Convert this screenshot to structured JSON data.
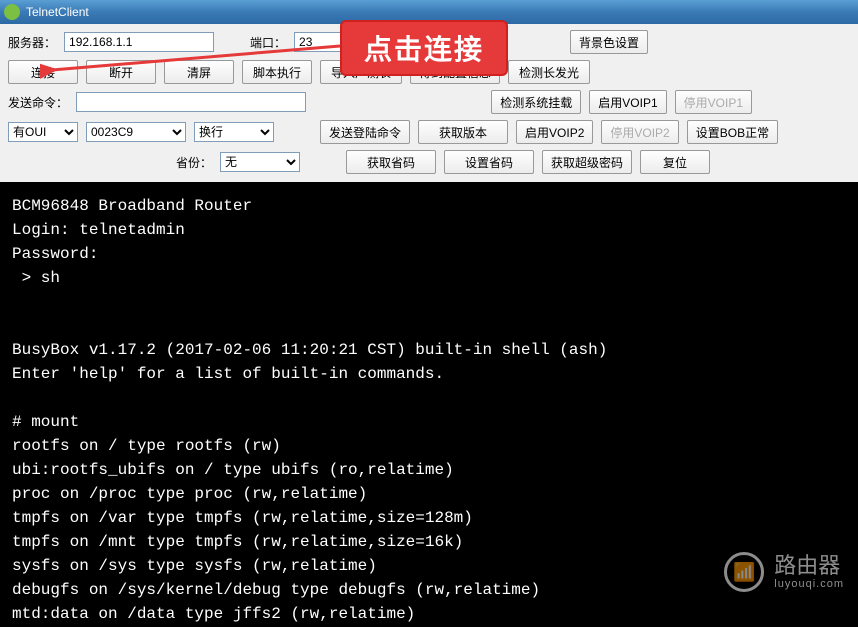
{
  "window": {
    "title": "TelnetClient"
  },
  "row1": {
    "server_label": "服务器：",
    "server_value": "192.168.1.1",
    "port_label": "端口：",
    "port_value": "23",
    "bgcolor_btn": "背景色设置"
  },
  "row2": {
    "connect": "连接",
    "disconnect": "断开",
    "clear": "清屏",
    "script_exec": "脚本执行",
    "import_prodtest": "导入产测表",
    "get_config": "得到配置信息",
    "detect_long_light": "检测长发光"
  },
  "row3": {
    "send_cmd_label": "发送命令：",
    "send_cmd_value": "",
    "detect_sys_load": "检测系统挂载",
    "enable_voip1": "启用VOIP1",
    "disable_voip1": "停用VOIP1"
  },
  "row4": {
    "oui_sel": "有OUI",
    "oui_code": "0023C9",
    "wrap_sel": "换行",
    "send_login_cmd": "发送登陆命令",
    "get_version": "获取版本",
    "enable_voip2": "启用VOIP2",
    "disable_voip2": "停用VOIP2",
    "set_bob_normal": "设置BOB正常"
  },
  "row5": {
    "province_label": "省份：",
    "province_value": "无",
    "get_prov_code": "获取省码",
    "set_prov_code": "设置省码",
    "get_super_pwd": "获取超级密码",
    "reset": "复位"
  },
  "terminal_lines": [
    "BCM96848 Broadband Router",
    "Login: telnetadmin",
    "Password:",
    " > sh",
    "",
    "",
    "BusyBox v1.17.2 (2017-02-06 11:20:21 CST) built-in shell (ash)",
    "Enter 'help' for a list of built-in commands.",
    "",
    "# mount",
    "rootfs on / type rootfs (rw)",
    "ubi:rootfs_ubifs on / type ubifs (ro,relatime)",
    "proc on /proc type proc (rw,relatime)",
    "tmpfs on /var type tmpfs (rw,relatime,size=128m)",
    "tmpfs on /mnt type tmpfs (rw,relatime,size=16k)",
    "sysfs on /sys type sysfs (rw,relatime)",
    "debugfs on /sys/kernel/debug type debugfs (rw,relatime)",
    "mtd:data on /data type jffs2 (rw,relatime)"
  ],
  "annotation": {
    "text": "点击连接"
  },
  "watermark": {
    "text": "路由器",
    "sub": "luyouqi.com"
  }
}
